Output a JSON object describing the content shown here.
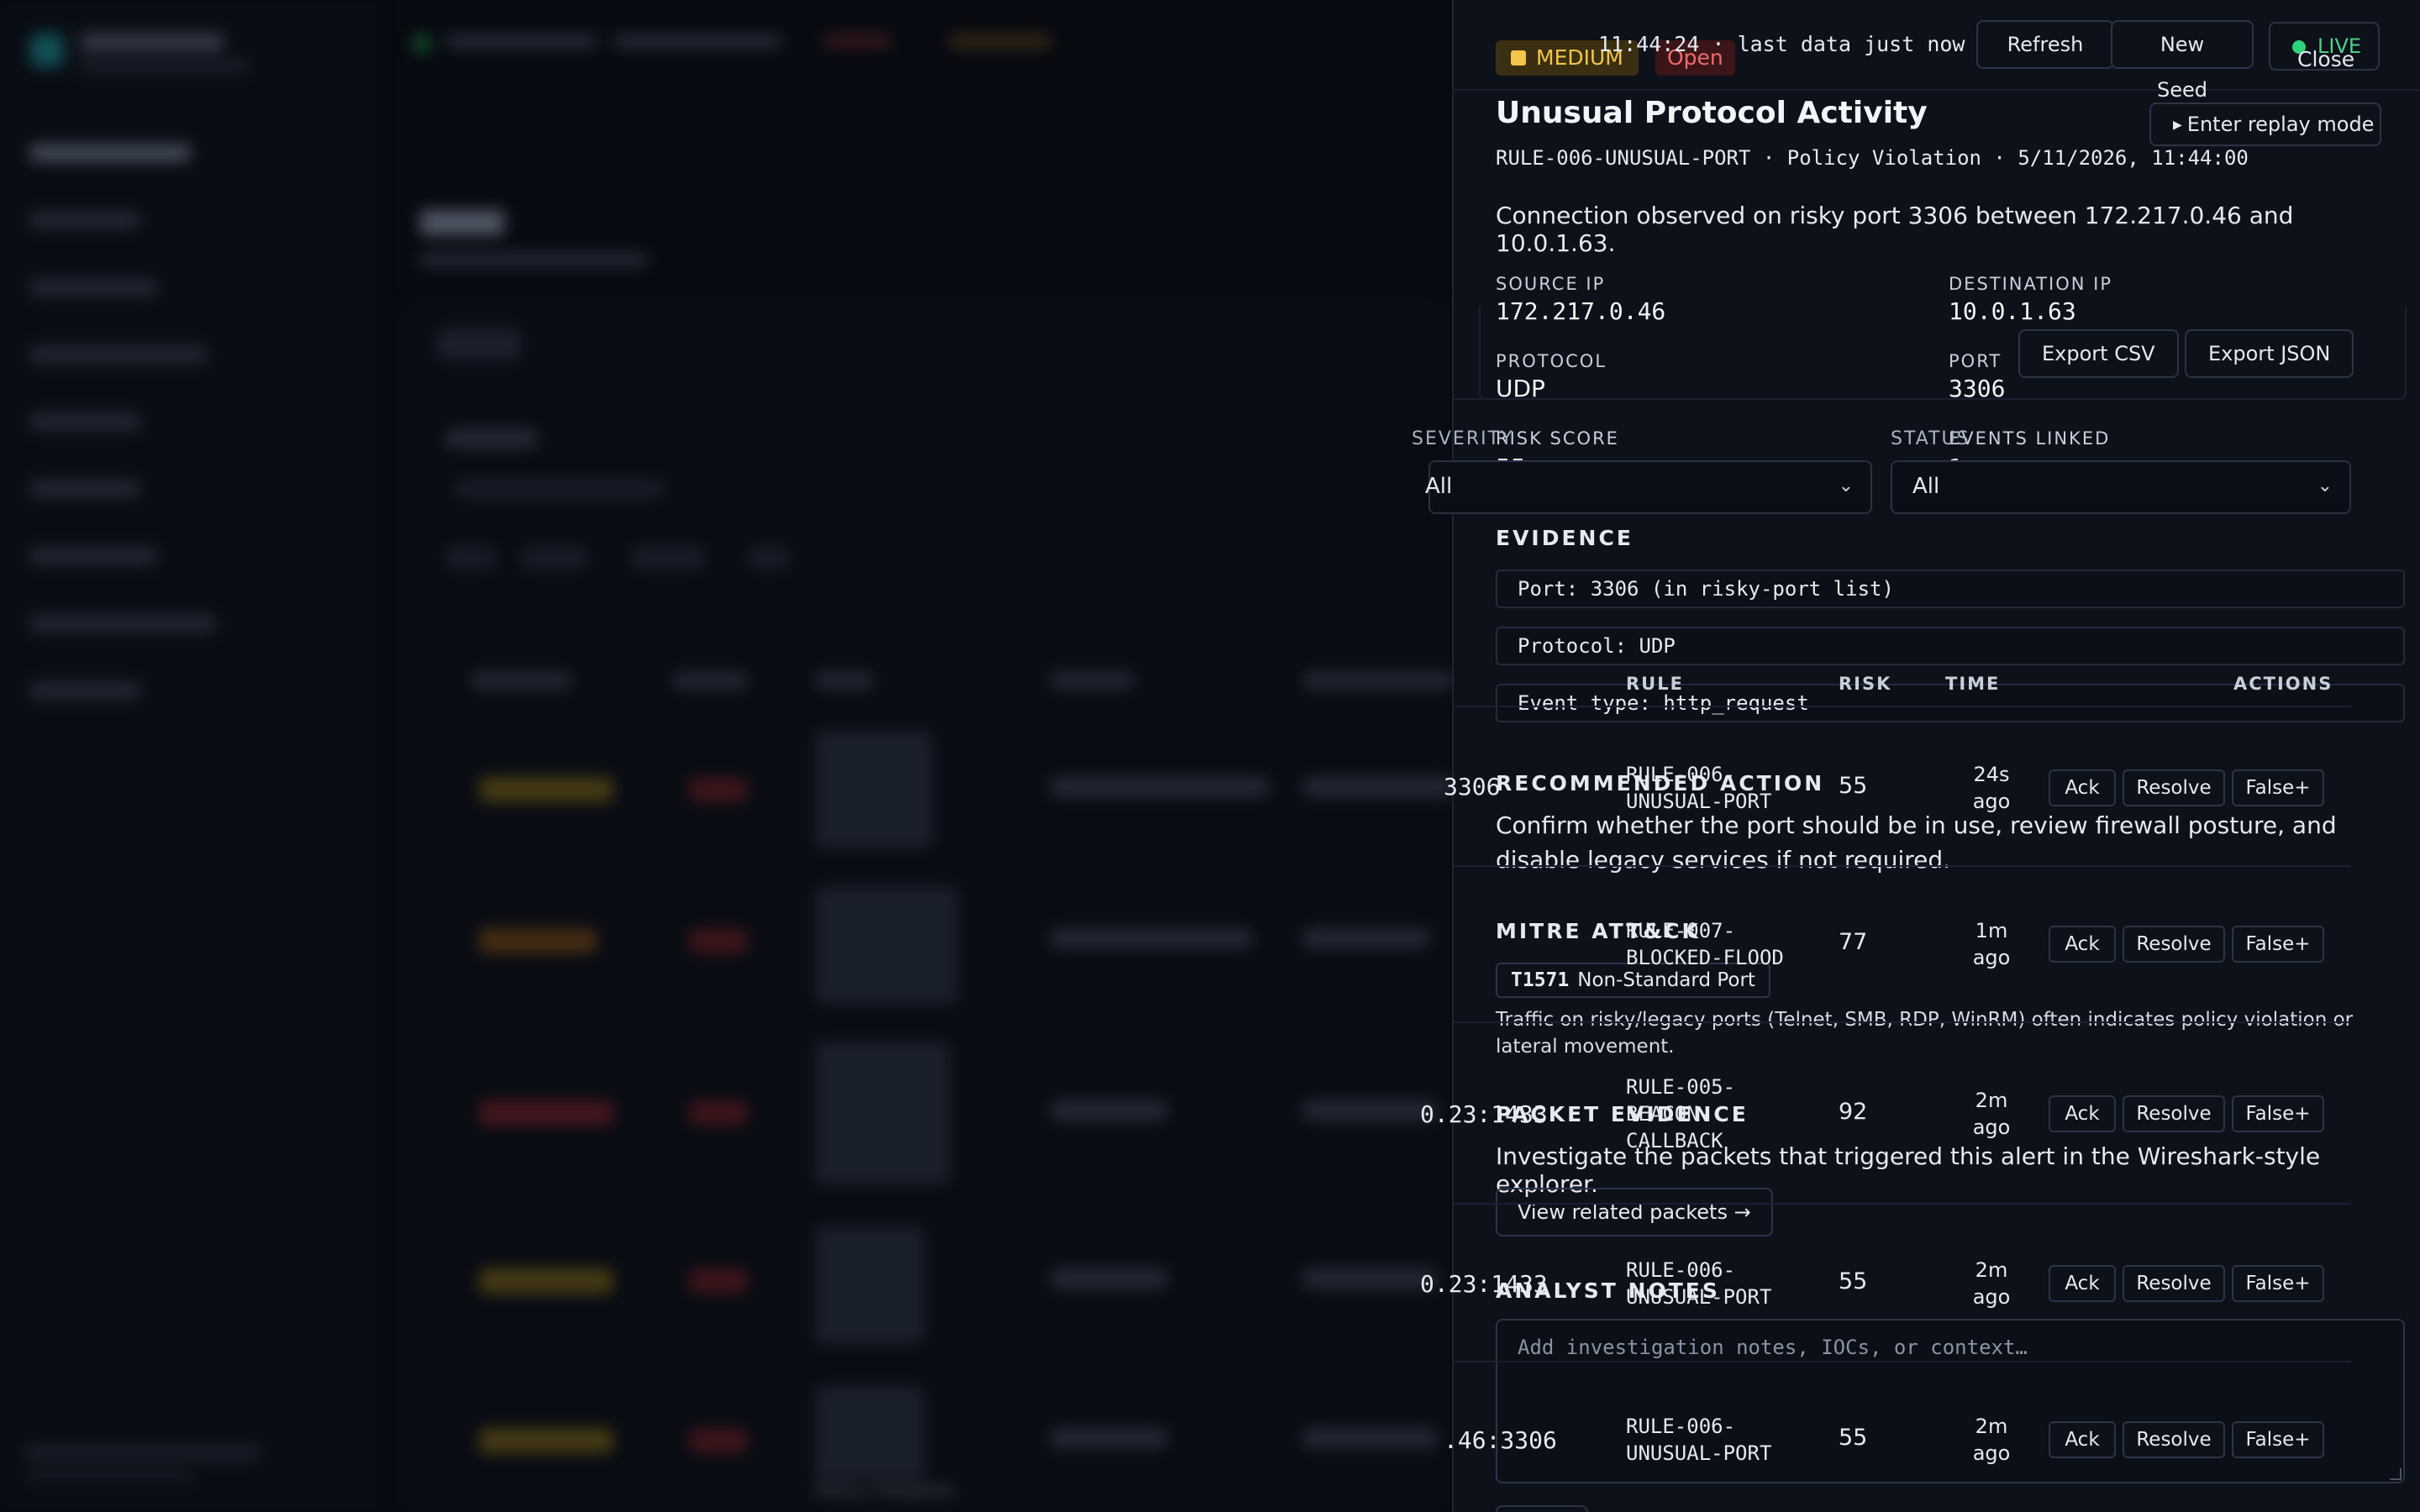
{
  "alert": {
    "severity": "MEDIUM",
    "status": "Open",
    "title": "Unusual Protocol Activity",
    "subtitle": "RULE-006-UNUSUAL-PORT · Policy Violation · 5/11/2026, 11:44:00",
    "description": "Connection observed on risky port 3306 between 172.217.0.46 and 10.0.1.63.",
    "fields": {
      "source_ip_label": "SOURCE IP",
      "source_ip": "172.217.0.46",
      "dest_ip_label": "DESTINATION IP",
      "dest_ip": "10.0.1.63",
      "protocol_label": "PROTOCOL",
      "protocol": "UDP",
      "port_label": "PORT",
      "port": "3306",
      "risk_label": "RISK SCORE",
      "risk": "55",
      "events_label": "EVENTS LINKED",
      "events": "1"
    },
    "evidence_heading": "EVIDENCE",
    "evidence": [
      "Port: 3306 (in risky-port list)",
      "Protocol: UDP",
      "Event type: http_request"
    ],
    "recommended_heading": "RECOMMENDED ACTION",
    "recommended": "Confirm whether the port should be in use, review firewall posture, and disable legacy services if not required.",
    "mitre_heading": "MITRE ATT&CK",
    "mitre_id": "T1571",
    "mitre_name": "Non-Standard Port",
    "mitre_desc": "Traffic on risky/legacy ports (Telnet, SMB, RDP, WinRM) often indicates policy violation or lateral movement.",
    "packet_heading": "PACKET EVIDENCE",
    "packet_desc": "Investigate the packets that triggered this alert in the Wireshark-style explorer.",
    "packet_button": "View related packets →",
    "notes_heading": "ANALYST NOTES",
    "notes_placeholder": "Add investigation notes, IOCs, or context…"
  },
  "topbar": {
    "last_data": "11:44:24 · last data just now",
    "refresh": "Refresh",
    "new_seed": "New Seed",
    "live": "LIVE",
    "close": "Close",
    "replay": "Enter replay mode"
  },
  "filters": {
    "severity_label": "SEVERITY",
    "severity_value": "All",
    "status_label": "STATUS",
    "status_value": "All",
    "export_csv": "Export CSV",
    "export_json": "Export JSON"
  },
  "table": {
    "headers": {
      "rule": "RULE",
      "risk": "RISK",
      "time": "TIME",
      "actions": "ACTIONS"
    },
    "actions": {
      "ack": "Ack",
      "resolve": "Resolve",
      "false_pos": "False+"
    },
    "rows": [
      {
        "rule": [
          "RULE-006-",
          "UNUSUAL-PORT"
        ],
        "risk": "55",
        "time": [
          "24s",
          "ago"
        ],
        "dest": "3306"
      },
      {
        "rule": [
          "RULE-007-",
          "BLOCKED-FLOOD"
        ],
        "risk": "77",
        "time": [
          "1m",
          "ago"
        ],
        "dest": ""
      },
      {
        "rule": [
          "RULE-005-",
          "BEACON-",
          "CALLBACK"
        ],
        "risk": "92",
        "time": [
          "2m",
          "ago"
        ],
        "dest": "0.23:1433"
      },
      {
        "rule": [
          "RULE-006-",
          "UNUSUAL-PORT"
        ],
        "risk": "55",
        "time": [
          "2m",
          "ago"
        ],
        "dest": "0.23:1433"
      },
      {
        "rule": [
          "RULE-006-",
          "UNUSUAL-PORT"
        ],
        "risk": "55",
        "time": [
          "2m",
          "ago"
        ],
        "dest": ".46:3306"
      }
    ]
  },
  "background": {
    "row_footer": "Policy Violation"
  }
}
